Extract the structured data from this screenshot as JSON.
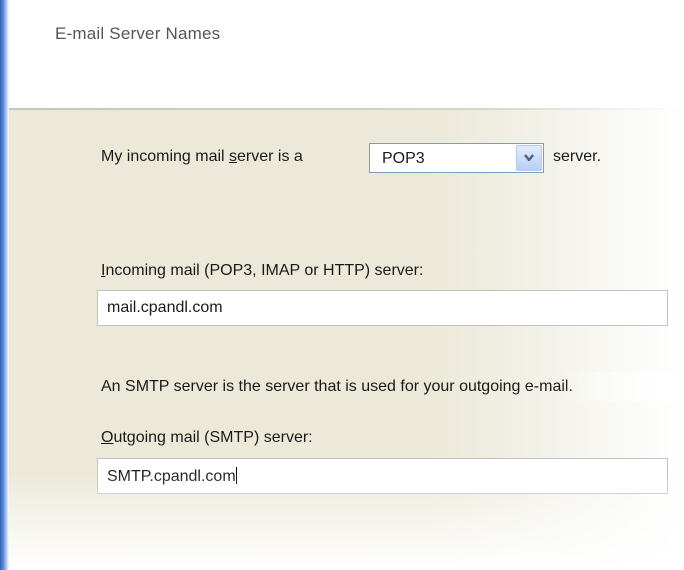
{
  "header": {
    "title": "E-mail Server Names"
  },
  "incoming_type": {
    "prefix": "My incoming mail ",
    "prefix_underlined": "s",
    "prefix_rest": "erver is a",
    "selected": "POP3",
    "suffix": "server."
  },
  "incoming_server": {
    "label_underlined": "I",
    "label_rest": "ncoming mail (POP3, IMAP or HTTP) server:",
    "value": "mail.cpandl.com"
  },
  "smtp_description": "An SMTP server is the server that is used for your outgoing e-mail.",
  "outgoing_server": {
    "label_underlined": "O",
    "label_rest": "utgoing mail (SMTP) server:",
    "value": "SMTP.cpandl.com"
  },
  "icons": {
    "dropdown": "chevron-down-icon"
  },
  "colors": {
    "accent": "#2d5fb8",
    "panel": "#ece9d8"
  }
}
